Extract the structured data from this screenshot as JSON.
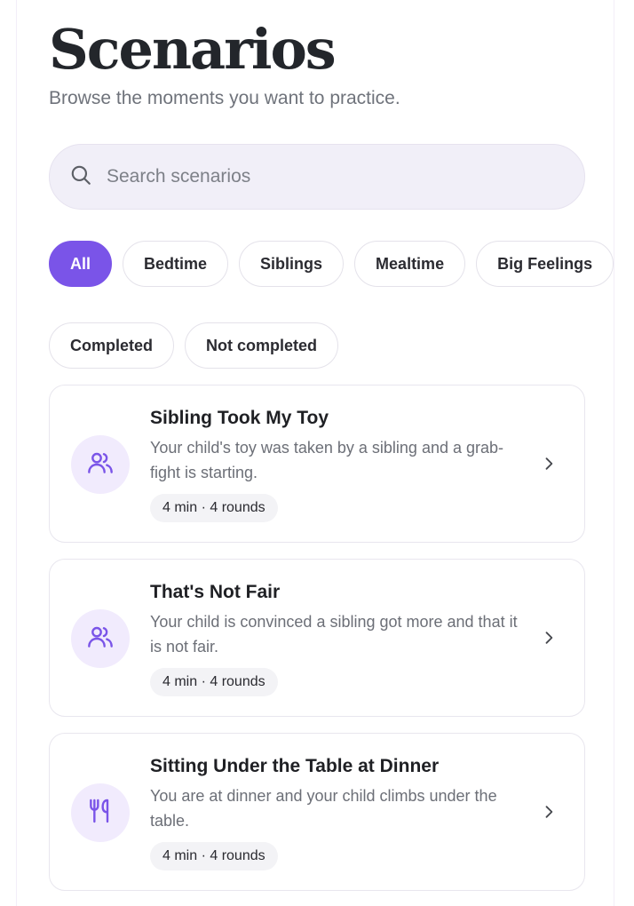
{
  "header": {
    "title": "Scenarios",
    "subtitle": "Browse the moments you want to practice."
  },
  "search": {
    "placeholder": "Search scenarios",
    "icon": "search-icon"
  },
  "filters": {
    "row1": [
      {
        "label": "All",
        "active": true
      },
      {
        "label": "Bedtime",
        "active": false
      },
      {
        "label": "Siblings",
        "active": false
      },
      {
        "label": "Mealtime",
        "active": false
      },
      {
        "label": "Big Feelings",
        "active": false
      }
    ],
    "row2": [
      {
        "label": "Completed",
        "active": false
      },
      {
        "label": "Not completed",
        "active": false
      }
    ]
  },
  "scenarios": [
    {
      "title": "Sibling Took My Toy",
      "description": "Your child's toy was taken by a sibling and a grab-fight is starting.",
      "meta": "4 min · 4 rounds",
      "icon": "users-icon"
    },
    {
      "title": "That's Not Fair",
      "description": "Your child is convinced a sibling got more and that it is not fair.",
      "meta": "4 min · 4 rounds",
      "icon": "users-icon"
    },
    {
      "title": "Sitting Under the Table at Dinner",
      "description": "You are at dinner and your child climbs under the table.",
      "meta": "4 min · 4 rounds",
      "icon": "utensils-icon"
    }
  ],
  "colors": {
    "accent": "#7a54e8",
    "icon_bg": "#f1ebfd",
    "title": "#23262b",
    "muted": "#6f737b"
  }
}
